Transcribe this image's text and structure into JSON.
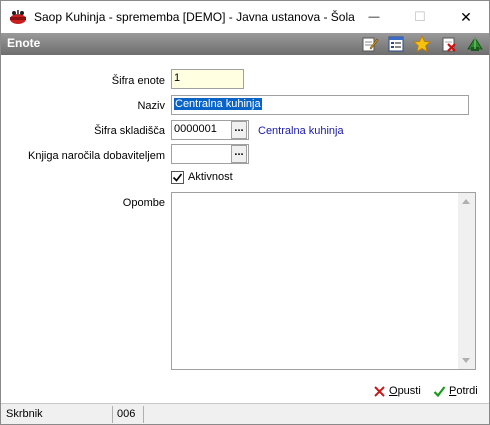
{
  "window": {
    "title": "Saop Kuhinja - sprememba [DEMO] - Javna ustanova - Šola",
    "minimize_glyph": "—",
    "maximize_glyph": "☐",
    "close_glyph": "✕"
  },
  "header": {
    "title": "Enote",
    "toolbar_icons": [
      "edit-icon",
      "list-icon",
      "favorite-star-icon",
      "delete-icon",
      "exit-icon"
    ]
  },
  "form": {
    "sifra_enote": {
      "label": "Šifra enote",
      "value": "1"
    },
    "naziv": {
      "label": "Naziv",
      "value": "Centralna kuhinja"
    },
    "sifra_skladisca": {
      "label": "Šifra skladišča",
      "value": "0000001",
      "lookup_text": "Centralna kuhinja",
      "button": "..."
    },
    "knjiga": {
      "label": "Knjiga naročila dobaviteljem",
      "value": "",
      "button": "..."
    },
    "aktivnost": {
      "label": "Aktivnost",
      "checked": true
    },
    "opombe": {
      "label": "Opombe",
      "value": ""
    }
  },
  "buttons": {
    "opusti_first": "O",
    "opusti_rest": "pusti",
    "potrdi_first": "P",
    "potrdi_rest": "otrdi"
  },
  "status": {
    "user": "Skrbnik",
    "code": "006"
  },
  "colors": {
    "header_gradient_top": "#9a9a9a",
    "header_gradient_bottom": "#6e6e6e",
    "link": "#1a1aa6",
    "selection": "#0a64c8",
    "field_highlight": "#ffffe1"
  }
}
